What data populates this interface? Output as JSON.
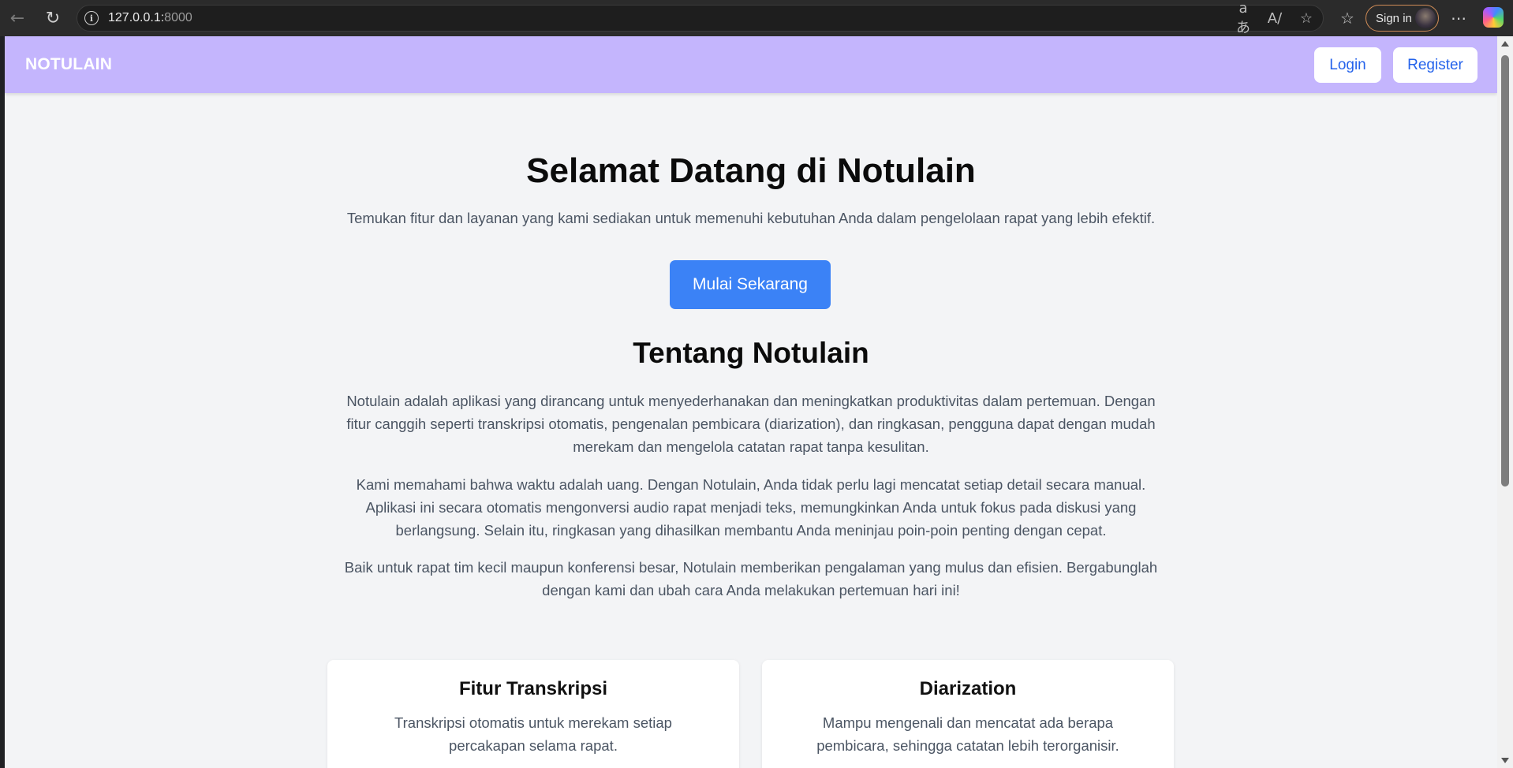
{
  "browser": {
    "url_host": "127.0.0.1:",
    "url_port": "8000",
    "sign_in_label": "Sign in"
  },
  "navbar": {
    "brand": "NOTULAIN",
    "login_label": "Login",
    "register_label": "Register"
  },
  "hero": {
    "title": "Selamat Datang di Notulain",
    "subtitle": "Temukan fitur dan layanan yang kami sediakan untuk memenuhi kebutuhan Anda dalam pengelolaan rapat yang lebih efektif.",
    "cta_label": "Mulai Sekarang"
  },
  "about": {
    "title": "Tentang Notulain",
    "paragraphs": [
      "Notulain adalah aplikasi yang dirancang untuk menyederhanakan dan meningkatkan produktivitas dalam pertemuan. Dengan fitur canggih seperti transkripsi otomatis, pengenalan pembicara (diarization), dan ringkasan, pengguna dapat dengan mudah merekam dan mengelola catatan rapat tanpa kesulitan.",
      "Kami memahami bahwa waktu adalah uang. Dengan Notulain, Anda tidak perlu lagi mencatat setiap detail secara manual. Aplikasi ini secara otomatis mengonversi audio rapat menjadi teks, memungkinkan Anda untuk fokus pada diskusi yang berlangsung. Selain itu, ringkasan yang dihasilkan membantu Anda meninjau poin-poin penting dengan cepat.",
      "Baik untuk rapat tim kecil maupun konferensi besar, Notulain memberikan pengalaman yang mulus dan efisien. Bergabunglah dengan kami dan ubah cara Anda melakukan pertemuan hari ini!"
    ]
  },
  "features": [
    {
      "title": "Fitur Transkripsi",
      "description": "Transkripsi otomatis untuk merekam setiap percakapan selama rapat."
    },
    {
      "title": "Diarization",
      "description": "Mampu mengenali dan mencatat ada berapa pembicara, sehingga catatan lebih terorganisir."
    }
  ],
  "colors": {
    "navbar_bg": "#c4b5fd",
    "cta_bg": "#3b82f6",
    "link_text": "#2563eb",
    "page_bg": "#f3f4f6"
  }
}
